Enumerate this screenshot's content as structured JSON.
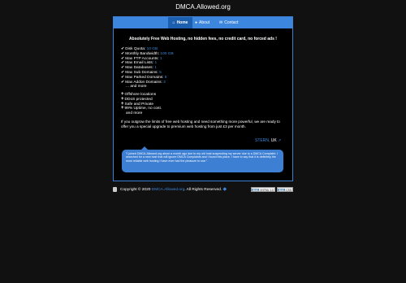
{
  "site": {
    "title": "DMCA.Allowed.org"
  },
  "nav": {
    "home": "Home",
    "about": "About",
    "contact": "Contact"
  },
  "headline": "Absolutely Free Web Hosting, no hidden fees, no credit card, no forced ads !",
  "features": [
    {
      "label": "Disk Quota:",
      "value": "10 GB"
    },
    {
      "label": "Monthly Bandwidth:",
      "value": "100 GB"
    },
    {
      "label": "Max FTP Accounts:",
      "value": "1"
    },
    {
      "label": "Max Email Lists:",
      "value": "1"
    },
    {
      "label": "Max Databases:",
      "value": "1"
    },
    {
      "label": "Max Sub Domains:",
      "value": "5"
    },
    {
      "label": "Max Parked Domains:",
      "value": "5"
    },
    {
      "label": "Max Addon Domains:",
      "value": "3"
    }
  ],
  "features_more": "... and more",
  "extras": [
    "Offshore locations",
    "DDoS protected",
    "Safe and Private",
    "99% Uptime, no cost.",
    "and more"
  ],
  "upgrade_text": "If you outgrow the limits of free web hosting and need something more powerful, we are ready to offer you a special upgrade to premium web hosting from just £3 per month.",
  "testimonial": {
    "author": "STERN",
    "country": "UK",
    "text": "\"I joined DMCA.Allowed.org about a month ago due to my old host suspending my server due to a DMCA Complaint. I searched for a new host that will ignore DMCA Complaints and I found this place. I have to say that it is definitely the most reliable web hosting I have ever had the pleasure to use.\""
  },
  "footer": {
    "copyright_prefix": "Copyright © 2020",
    "site_link": "DMCA.Allowed.org",
    "copyright_suffix": ". All Rights Reserved.",
    "badge1_left": "W3C",
    "badge1_right": "XHTML 1.0",
    "badge2_left": "W3C",
    "badge2_right": "CSS"
  },
  "colors": {
    "accent": "#3c87dd",
    "nav_active": "#1b5fae",
    "background": "#111111",
    "panel": "#000000"
  }
}
